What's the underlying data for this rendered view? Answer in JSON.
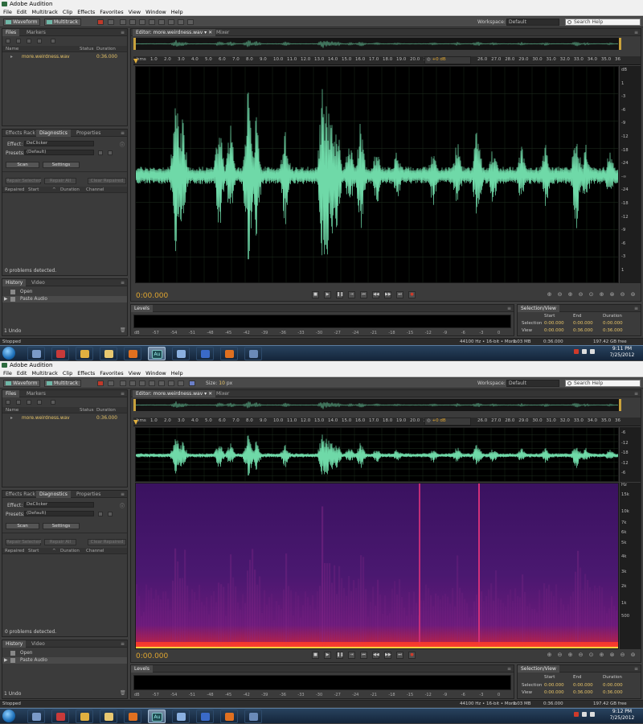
{
  "app": {
    "title": "Adobe Audition",
    "menu": [
      "File",
      "Edit",
      "Multitrack",
      "Clip",
      "Effects",
      "Favorites",
      "View",
      "Window",
      "Help"
    ]
  },
  "toolbar": {
    "waveform_label": "Waveform",
    "multitrack_label": "Multitrack",
    "workspace_label": "Workspace:",
    "workspace_value": "Default",
    "search_placeholder": "Search Help",
    "size_label": "Size:",
    "size_value": "10",
    "size_unit": "px"
  },
  "files_panel": {
    "tabs": [
      "Files",
      "Markers"
    ],
    "columns": [
      "Name",
      "Status",
      "Duration"
    ],
    "items": [
      {
        "name": "more.weirdness.wav",
        "duration": "0:36.000"
      }
    ]
  },
  "diagnostics_panel": {
    "tabs": [
      "Effects Rack",
      "Diagnostics",
      "Properties"
    ],
    "effect_label": "Effect:",
    "effect_value": "DeClicker",
    "presets_label": "Presets:",
    "presets_value": "(Default)",
    "scan_label": "Scan",
    "settings_label": "Settings",
    "repair_selected": "Repair Selected",
    "repair_all": "Repair All",
    "clear_repaired": "Clear Repaired",
    "columns": [
      "Repaired",
      "Start",
      "Duration",
      "Channel"
    ],
    "status": "0 problems detected."
  },
  "history_panel": {
    "tabs": [
      "History",
      "Video"
    ],
    "items": [
      "Open",
      "Paste Audio"
    ],
    "undo_count": "1 Undo"
  },
  "editor": {
    "tabs": [
      "Editor: more.weirdness.wav",
      "Mixer"
    ],
    "time_ticks_left": [
      "hms",
      "1.0",
      "2.0",
      "3.0",
      "4.0",
      "5.0",
      "6.0",
      "7.0",
      "8.0",
      "9.0",
      "10.0",
      "11.0",
      "12.0",
      "13.0",
      "14.0",
      "15.0",
      "16.0",
      "17.0",
      "18.0",
      "19.0",
      "20.0",
      "21.0"
    ],
    "time_ticks_right": [
      "26.0",
      "27.0",
      "28.0",
      "29.0",
      "30.0",
      "31.0",
      "32.0",
      "33.0",
      "34.0",
      "35.0",
      "36"
    ],
    "hud_gain": "+0 dB",
    "timecode": "0:00.000",
    "db_ticks_top": [
      "dB",
      "1",
      "-3",
      "-6",
      "-9",
      "-12",
      "-18",
      "-24",
      "-∞",
      "-24",
      "-18",
      "-12",
      "-9",
      "-6",
      "-3",
      "1"
    ],
    "db_ticks_bottom": [
      "-6",
      "-12",
      "-18",
      "-12",
      "-6"
    ],
    "spec_ticks": [
      "Hz",
      "15k",
      "10k",
      "7k",
      "6k",
      "5k",
      "4k",
      "3k",
      "2k",
      "1k",
      "500"
    ],
    "transport": [
      "stop",
      "play",
      "pause",
      "skip-selection",
      "previous",
      "rewind",
      "fast-forward",
      "next",
      "record"
    ]
  },
  "levels_panel": {
    "title": "Levels",
    "scale": [
      "dB",
      "-57",
      "-54",
      "-51",
      "-48",
      "-45",
      "-42",
      "-39",
      "-36",
      "-33",
      "-30",
      "-27",
      "-24",
      "-21",
      "-18",
      "-15",
      "-12",
      "-9",
      "-6",
      "-3",
      "0"
    ]
  },
  "selection_panel": {
    "title": "Selection/View",
    "columns": [
      "Start",
      "End",
      "Duration"
    ],
    "rows": [
      {
        "label": "Selection",
        "start": "0:00.000",
        "end": "0:00.000",
        "duration": "0:00.000"
      },
      {
        "label": "View",
        "start": "0:00.000",
        "end": "0:36.000",
        "duration": "0:36.000"
      }
    ]
  },
  "status_bar": {
    "state": "Stopped",
    "format": "44100 Hz • 16-bit • Mono",
    "size": "3.03 MB",
    "duration": "0:36.000",
    "free": "197.42 GB free"
  },
  "taskbar": {
    "time": "9:11 PM",
    "date": "7/25/2012",
    "time_bottom": "9:12 PM",
    "au_label": "Au"
  },
  "colors": {
    "waveform": "#6fd9a8",
    "timecode": "#e0a630",
    "accent_gold": "#c9a23c"
  }
}
